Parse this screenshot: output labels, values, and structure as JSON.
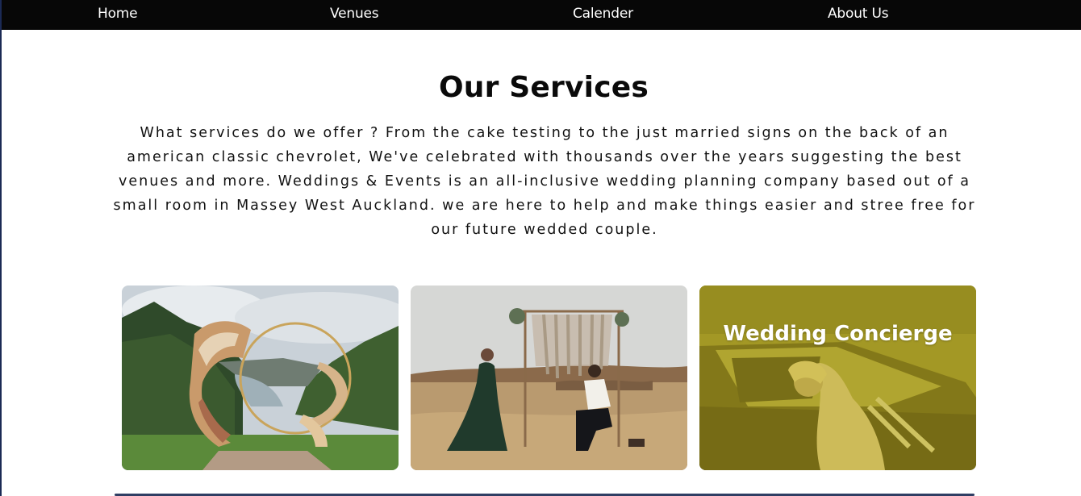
{
  "nav": {
    "items": [
      {
        "label": "Home"
      },
      {
        "label": "Venues"
      },
      {
        "label": "Calender"
      },
      {
        "label": "About Us"
      }
    ]
  },
  "services": {
    "title": "Our Services",
    "description": "What services do we offer ? From the cake testing to the just married signs on the back of an american classic chevrolet, We've celebrated with thousands over the years suggesting the best venues and more. Weddings & Events is an all-inclusive wedding planning company based out of a small room in Massey West Auckland. we are here to help and make things easier and stree free for our future wedded couple.",
    "cards": [
      {
        "image": "floral-arch-in-valley",
        "label": ""
      },
      {
        "image": "proposal-in-field",
        "label": ""
      },
      {
        "image": "bride-in-classic-car",
        "label": "Wedding Concierge"
      }
    ]
  },
  "colors": {
    "nav_bg": "#070707",
    "overlay": "#c9b21c"
  }
}
